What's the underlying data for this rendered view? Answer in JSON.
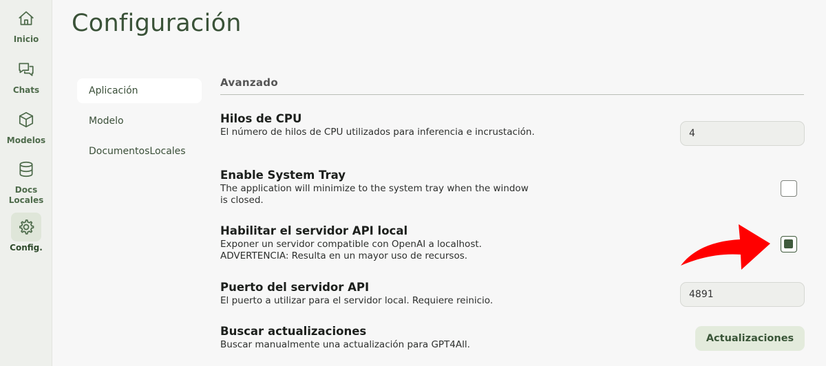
{
  "nav": {
    "items": [
      {
        "label": "Inicio",
        "icon": "home-icon"
      },
      {
        "label": "Chats",
        "icon": "chat-icon"
      },
      {
        "label": "Modelos",
        "icon": "cube-icon"
      },
      {
        "label": "Docs\nLocales",
        "label_line1": "Docs",
        "label_line2": "Locales",
        "icon": "database-icon"
      },
      {
        "label": "Config.",
        "icon": "gear-icon",
        "active": true
      }
    ]
  },
  "page": {
    "title": "Configuración"
  },
  "subnav": {
    "items": [
      {
        "label": "Aplicación",
        "active": true
      },
      {
        "label": "Modelo"
      },
      {
        "label": "DocumentosLocales"
      }
    ]
  },
  "section": {
    "title": "Avanzado"
  },
  "settings": {
    "cpu_threads": {
      "title": "Hilos de CPU",
      "description": "El número de hilos de CPU utilizados para inferencia e incrustación.",
      "value": "4"
    },
    "system_tray": {
      "title": "Enable System Tray",
      "description": "The application will minimize to the system tray when the window is closed.",
      "checked": false
    },
    "local_api_server": {
      "title": "Habilitar el servidor API local",
      "description": "Exponer un servidor compatible con OpenAI a localhost. ADVERTENCIA: Resulta en un mayor uso de recursos.",
      "checked": true
    },
    "api_port": {
      "title": "Puerto del servidor API",
      "description": "El puerto a utilizar para el servidor local. Requiere reinicio.",
      "value": "4891"
    },
    "check_updates": {
      "title": "Buscar actualizaciones",
      "description": "Buscar manualmente una actualización para GPT4All.",
      "button_label": "Actualizaciones"
    }
  },
  "colors": {
    "accent": "#3f5a3c",
    "annotation_arrow": "#ff0000",
    "rail_bg": "#eef0ec"
  }
}
